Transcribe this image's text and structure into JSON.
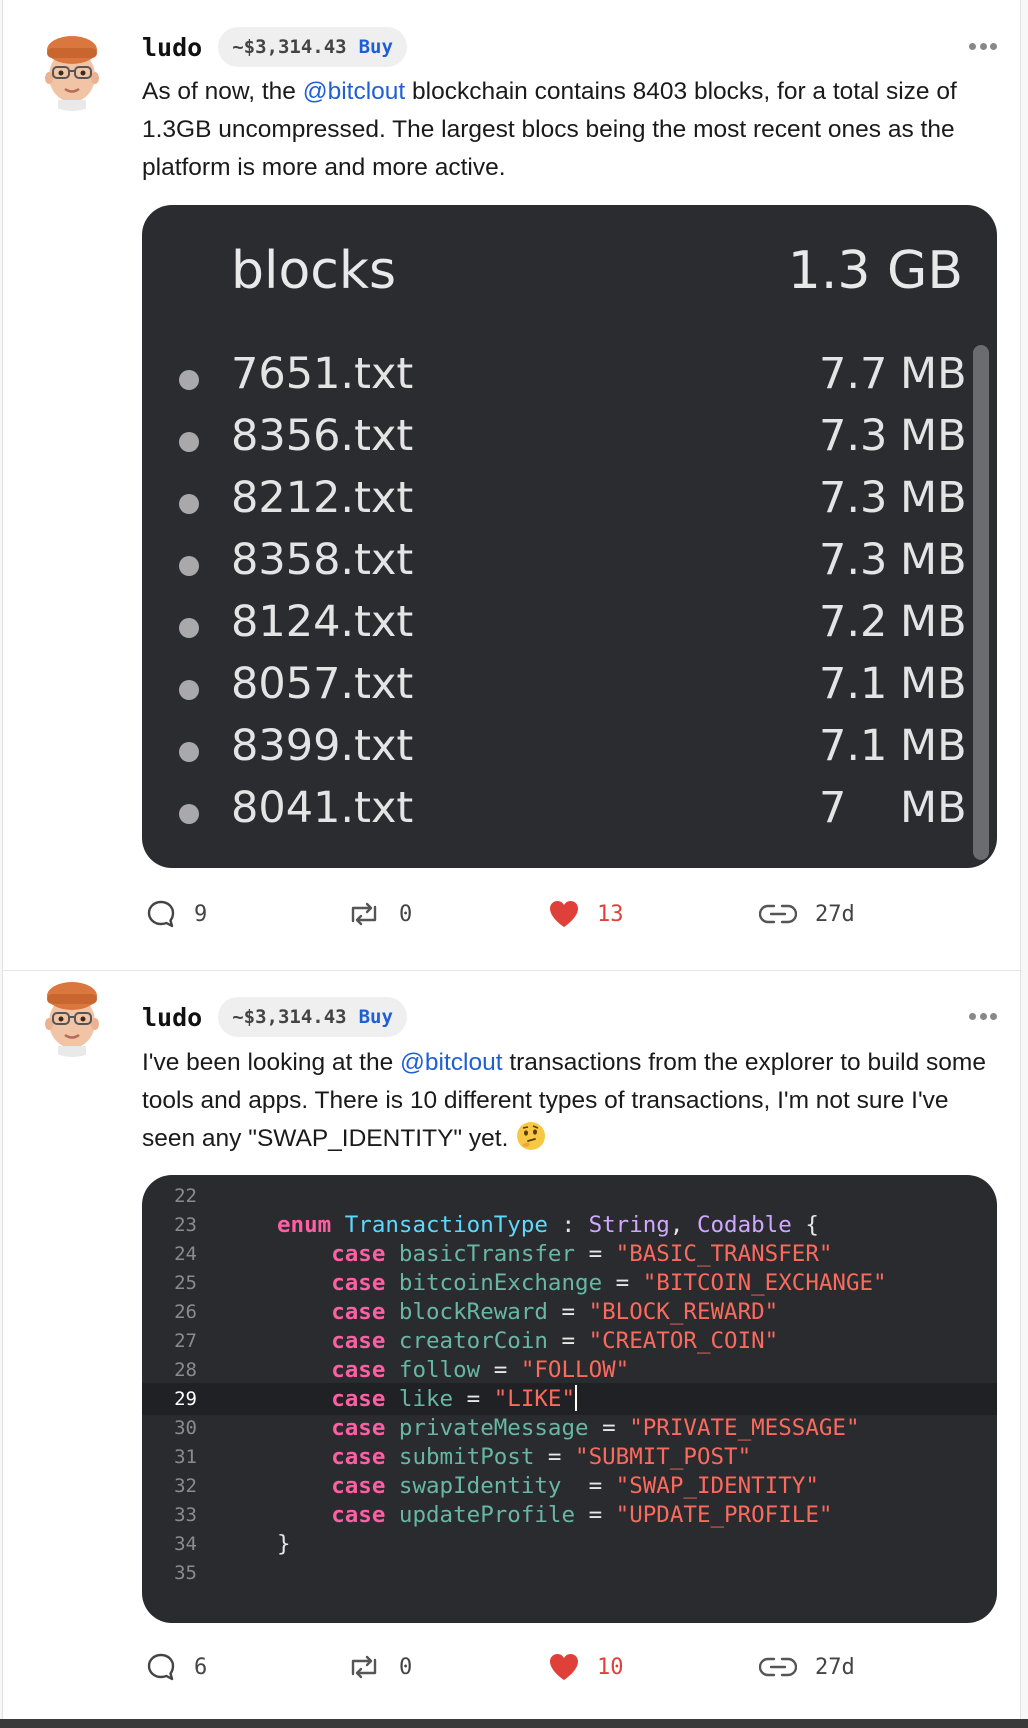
{
  "posts": [
    {
      "username": "ludo",
      "price": "~$3,314.43",
      "buy_label": "Buy",
      "text_before": "As of now, the ",
      "mention": "@bitclout",
      "text_after": " blockchain contains 8403 blocks, for a total size of 1.3GB uncompressed. The largest blocs being the most recent ones as the platform is more and more active.",
      "image": {
        "folder_name": "blocks",
        "folder_size": "1.3 GB",
        "files": [
          {
            "name": "7651.txt",
            "size": "7.7",
            "unit": "MB"
          },
          {
            "name": "8356.txt",
            "size": "7.3",
            "unit": "MB"
          },
          {
            "name": "8212.txt",
            "size": "7.3",
            "unit": "MB"
          },
          {
            "name": "8358.txt",
            "size": "7.3",
            "unit": "MB"
          },
          {
            "name": "8124.txt",
            "size": "7.2",
            "unit": "MB"
          },
          {
            "name": "8057.txt",
            "size": "7.1",
            "unit": "MB"
          },
          {
            "name": "8399.txt",
            "size": "7.1",
            "unit": "MB"
          },
          {
            "name": "8041.txt",
            "size": "7",
            "unit": "MB"
          }
        ]
      },
      "actions": {
        "comments": "9",
        "reposts": "0",
        "likes": "13",
        "age": "27d"
      }
    },
    {
      "username": "ludo",
      "price": "~$3,314.43",
      "buy_label": "Buy",
      "text_before": "I've been looking at the ",
      "mention": "@bitclout",
      "text_after": " transactions from the explorer to build some tools and apps. There is 10 different types of transactions, I'm not sure I've seen any \"SWAP_IDENTITY\" yet. ",
      "emoji": "thinking-face",
      "code": {
        "active_line": "29",
        "lines": [
          {
            "n": "22"
          },
          {
            "n": "23",
            "kw": "enum",
            "name": "TransactionType",
            "sep": " : ",
            "t1": "String",
            "comma": ", ",
            "t2": "Codable",
            "end": " {"
          },
          {
            "n": "24",
            "kw": "case",
            "name": "basicTransfer",
            "eq": " = ",
            "val": "\"BASIC_TRANSFER\""
          },
          {
            "n": "25",
            "kw": "case",
            "name": "bitcoinExchange",
            "eq": " = ",
            "val": "\"BITCOIN_EXCHANGE\""
          },
          {
            "n": "26",
            "kw": "case",
            "name": "blockReward",
            "eq": " = ",
            "val": "\"BLOCK_REWARD\""
          },
          {
            "n": "27",
            "kw": "case",
            "name": "creatorCoin",
            "eq": " = ",
            "val": "\"CREATOR_COIN\""
          },
          {
            "n": "28",
            "kw": "case",
            "name": "follow",
            "eq": " = ",
            "val": "\"FOLLOW\""
          },
          {
            "n": "29",
            "kw": "case",
            "name": "like",
            "eq": " = ",
            "val": "\"LIKE\""
          },
          {
            "n": "30",
            "kw": "case",
            "name": "privateMessage",
            "eq": " = ",
            "val": "\"PRIVATE_MESSAGE\""
          },
          {
            "n": "31",
            "kw": "case",
            "name": "submitPost",
            "eq": " = ",
            "val": "\"SUBMIT_POST\""
          },
          {
            "n": "32",
            "kw": "case",
            "name": "swapIdentity",
            "eq": "  = ",
            "val": "\"SWAP_IDENTITY\""
          },
          {
            "n": "33",
            "kw": "case",
            "name": "updateProfile",
            "eq": " = ",
            "val": "\"UPDATE_PROFILE\""
          },
          {
            "n": "34",
            "close": "}"
          },
          {
            "n": "35"
          }
        ]
      },
      "actions": {
        "comments": "6",
        "reposts": "0",
        "likes": "10",
        "age": "27d"
      }
    }
  ],
  "colors": {
    "mention": "#1f5fd6",
    "like": "#e0403a",
    "code_bg": "#2a2b2f",
    "files_bg": "#2b2c30"
  }
}
